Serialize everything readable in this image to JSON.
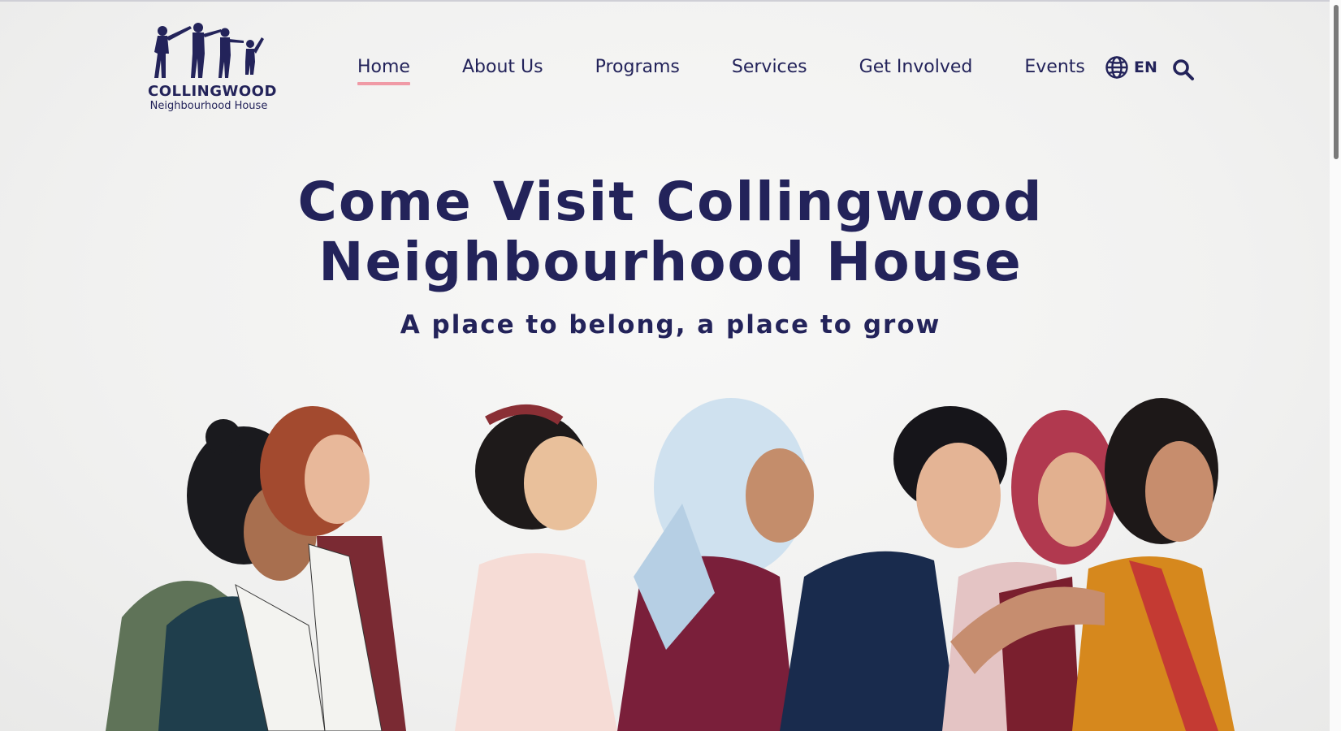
{
  "header": {
    "logo": {
      "line1": "COLLINGWOOD",
      "line2": "Neighbourhood House"
    },
    "nav": [
      {
        "label": "Home",
        "active": true
      },
      {
        "label": "About Us",
        "active": false
      },
      {
        "label": "Programs",
        "active": false
      },
      {
        "label": "Services",
        "active": false
      },
      {
        "label": "Get Involved",
        "active": false
      },
      {
        "label": "Events",
        "active": false
      }
    ],
    "language": {
      "icon": "globe-icon",
      "label": "EN"
    },
    "search": {
      "icon": "search-icon"
    }
  },
  "hero": {
    "title_line1": "Come Visit Collingwood",
    "title_line2": "Neighbourhood House",
    "subtitle": "A place to belong, a place to grow"
  },
  "colors": {
    "brand_navy": "#23235a",
    "accent_pink": "#f09aa6",
    "background": "#f4f4f3"
  }
}
